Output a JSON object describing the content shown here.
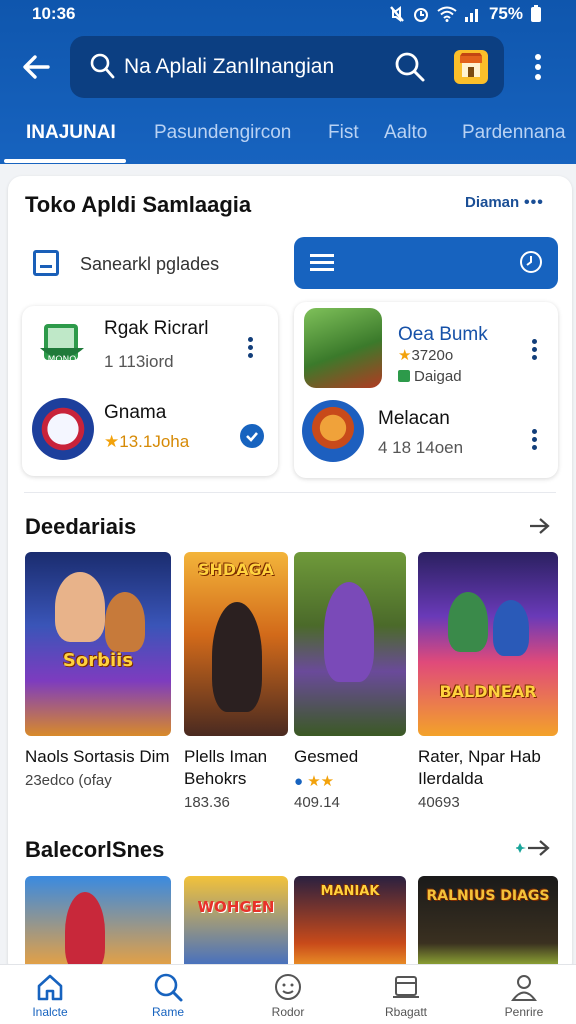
{
  "status": {
    "time": "10:36",
    "battery": "75%"
  },
  "search": {
    "value": "Na Aplali ZanIlnangian"
  },
  "tabs": [
    "INAJUNAI",
    "Pasundengircon",
    "Fist",
    "Aalto",
    "Pardennana"
  ],
  "card": {
    "title": "Toko Apldi Samlaagia",
    "link": "Diaman",
    "filter_label": "Sanearkl pglades"
  },
  "apps": [
    {
      "name": "Rgak Ricrarl",
      "sub": "1 113iord"
    },
    {
      "name": "Gnama",
      "sub": "13.1Joha",
      "star": "★"
    },
    {
      "name": "Oea Bumk",
      "sub": "3720o",
      "star": "★",
      "sub2": "Daigad"
    },
    {
      "name": "Melacan",
      "sub": "4 18 14oen"
    }
  ],
  "sections": {
    "games_title": "Deedariais",
    "recs_title": "BalecorlSnes"
  },
  "games": [
    {
      "title": "Naols Sortasis Dim",
      "meta": "23edco (ofay",
      "logo": "Sorbiis"
    },
    {
      "title": "Plells Iman Behokrs",
      "meta": "183.36",
      "logo": "SHDAGA"
    },
    {
      "title": "Gesmed",
      "meta": "409.14",
      "stars": "★★"
    },
    {
      "title": "Rater, Npar Hab Ilerdalda",
      "meta": "40693",
      "logo": "BALDNEAR"
    }
  ],
  "recs": [
    {
      "logo": ""
    },
    {
      "logo": "WOHGEN"
    },
    {
      "logo": "MANIAK"
    },
    {
      "logo": "RALNIUS DIAGS"
    }
  ],
  "nav": [
    "Inalcte",
    "Rame",
    "Rodor",
    "Rbagatt",
    "Penrire"
  ],
  "colors": {
    "primary": "#1763bf",
    "header": "#0f56ad",
    "searchbar": "#0c3f82",
    "star": "#f2a20c"
  },
  "icons": [
    "back-arrow-icon",
    "search-icon",
    "store-icon",
    "more-icon",
    "filter-icon",
    "menu-icon",
    "clock-icon",
    "check-icon",
    "arrow-right-icon",
    "home-icon",
    "search-nav-icon",
    "face-icon",
    "library-icon",
    "profile-icon"
  ]
}
